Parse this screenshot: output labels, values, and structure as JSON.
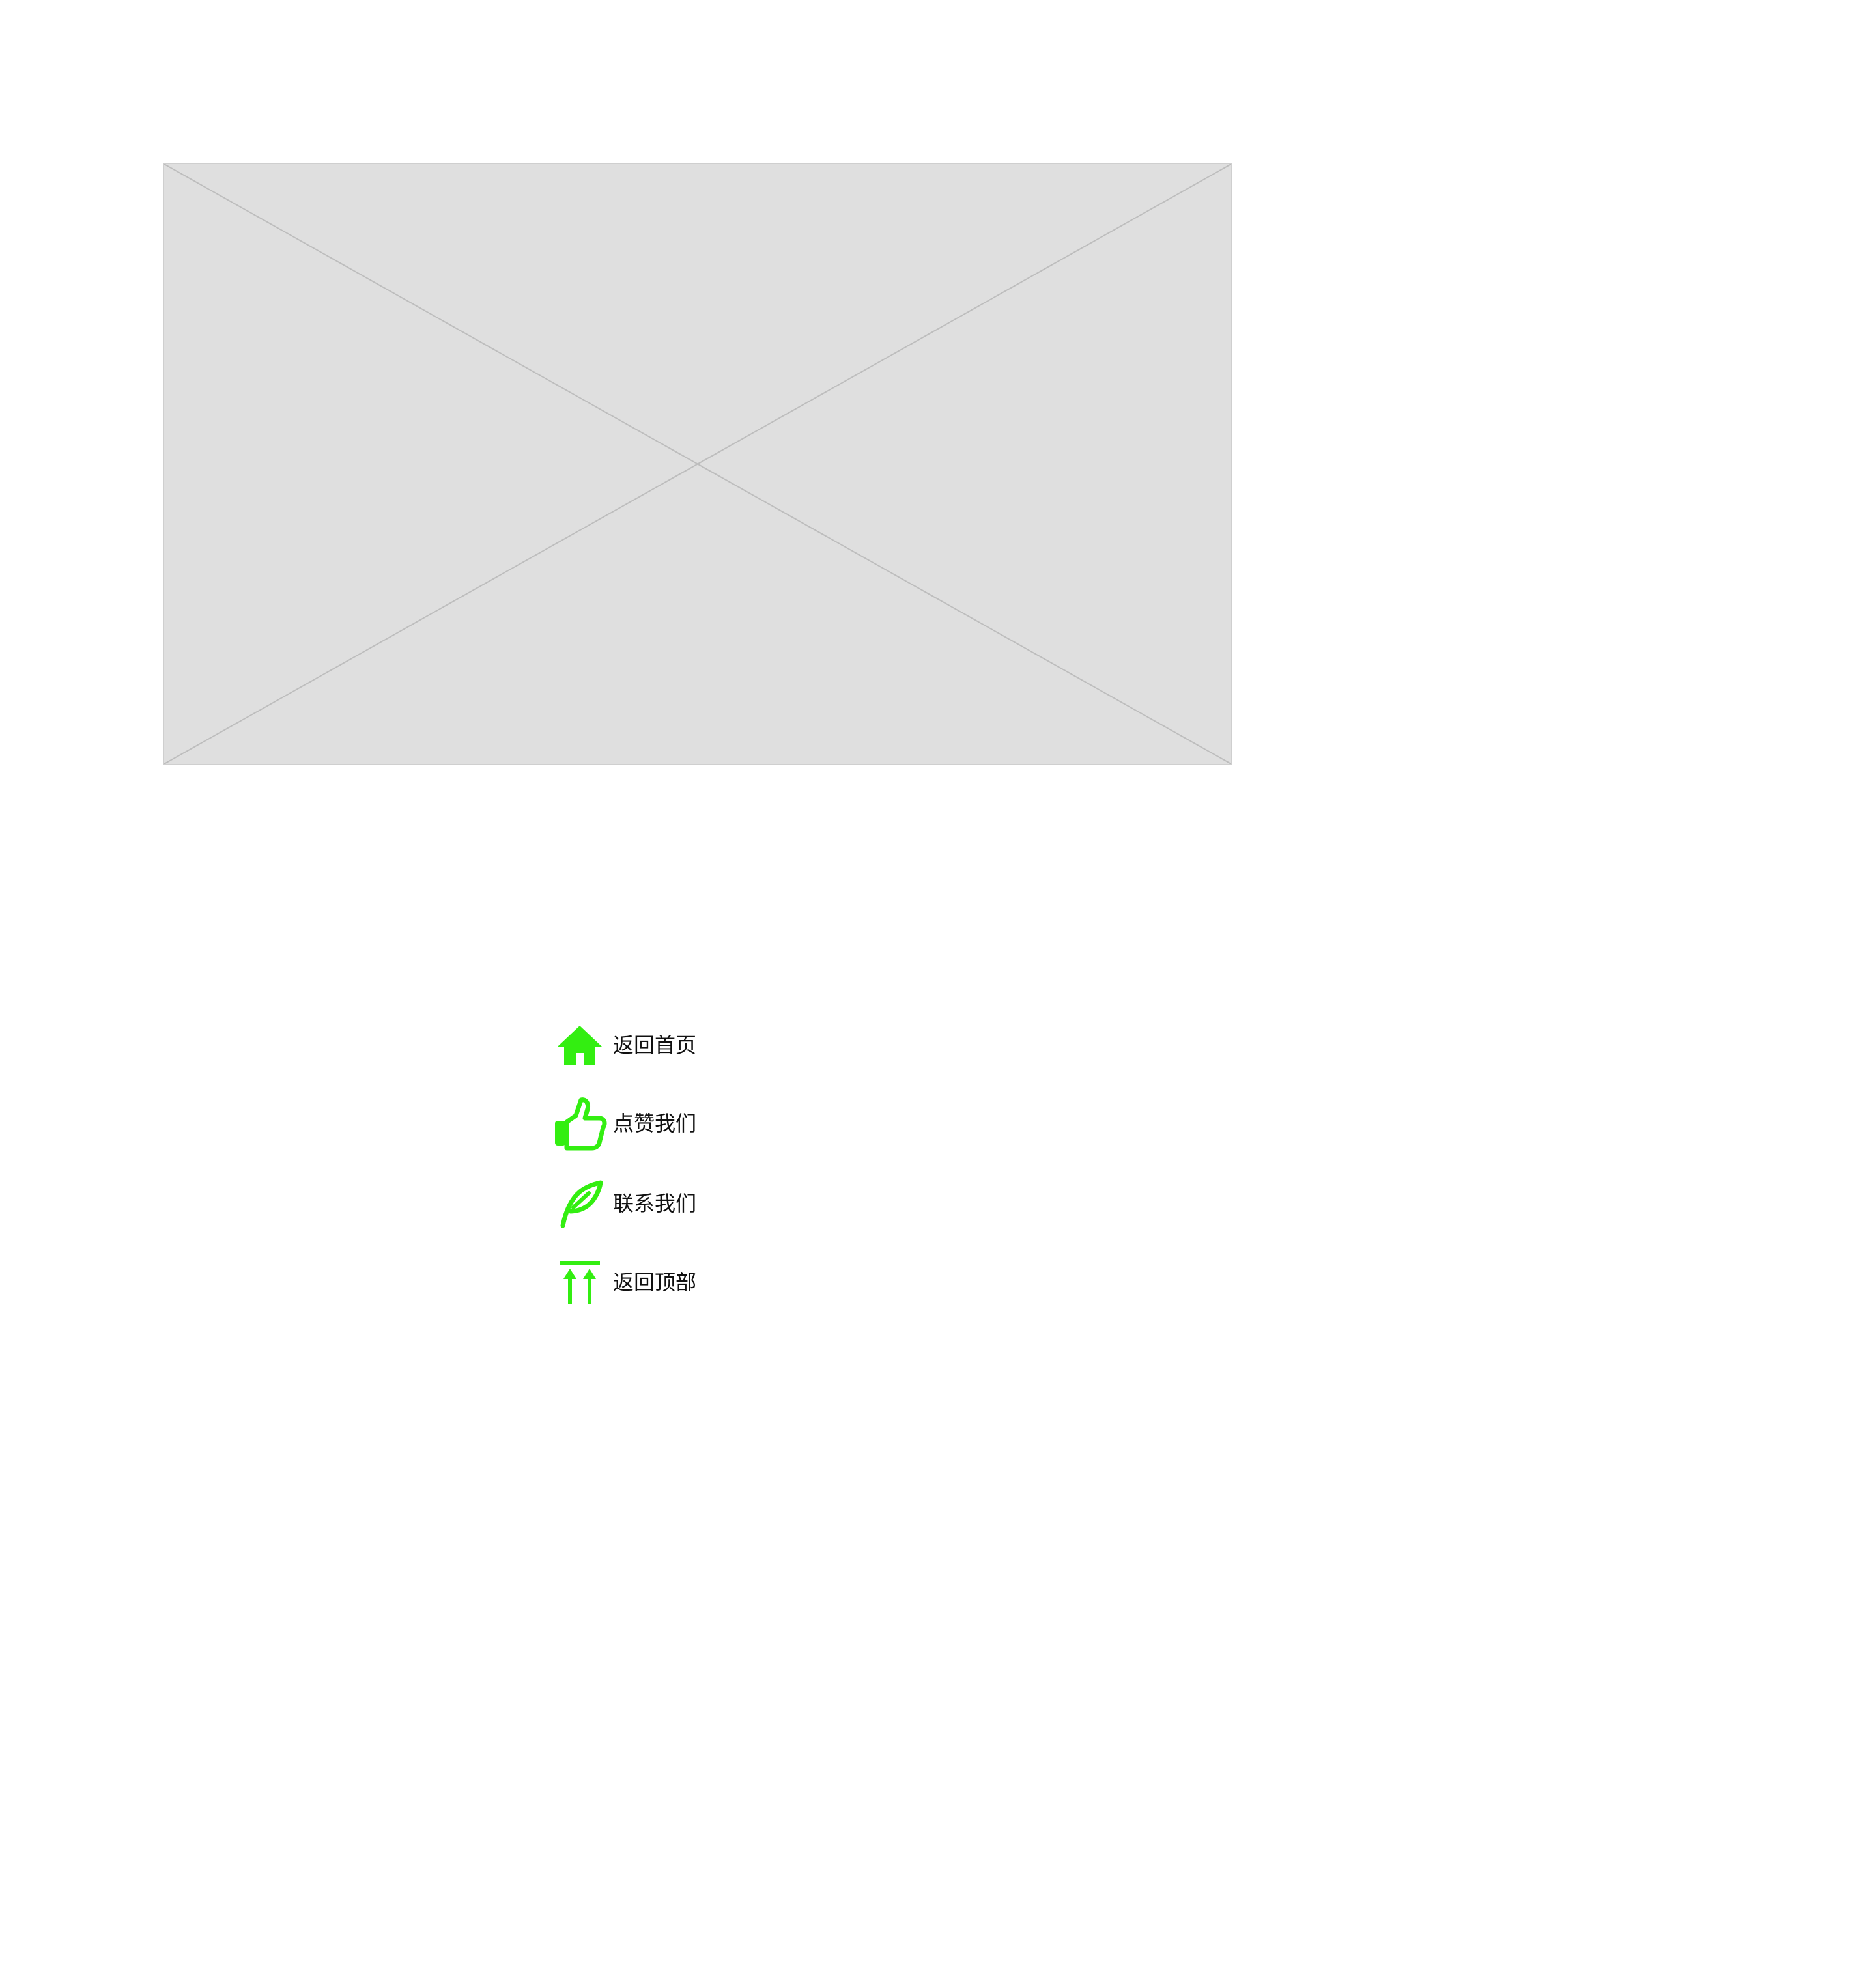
{
  "placeholder_image": {
    "kind": "empty-image-placeholder",
    "fill_color": "#dfdfdf",
    "stroke_color": "#bdbdbd"
  },
  "actions": {
    "icon_color": "#33ee11",
    "items": [
      {
        "label": "返回首页",
        "icon": "home-icon"
      },
      {
        "label": "点赞我们",
        "icon": "thumbs-up-icon"
      },
      {
        "label": "联系我们",
        "icon": "feather-icon"
      },
      {
        "label": "返回顶部",
        "icon": "back-to-top-icon"
      }
    ]
  }
}
